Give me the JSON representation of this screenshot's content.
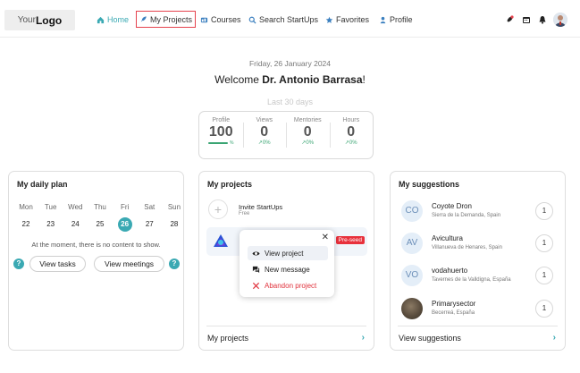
{
  "nav": {
    "logo_prefix": "Your",
    "logo_main": "Logo",
    "items": [
      {
        "label": "Home",
        "icon": "home-icon"
      },
      {
        "label": "My Projects",
        "icon": "rocket-icon"
      },
      {
        "label": "Courses",
        "icon": "courses-icon"
      },
      {
        "label": "Search StartUps",
        "icon": "search-icon"
      },
      {
        "label": "Favorites",
        "icon": "star-icon"
      },
      {
        "label": "Profile",
        "icon": "person-icon"
      }
    ],
    "active_item": "Home",
    "highlighted_item": "My Projects",
    "right_icons": [
      "rocket-icon",
      "calendar-icon",
      "bell-icon"
    ]
  },
  "header": {
    "date": "Friday, 26 January 2024",
    "welcome_prefix": "Welcome ",
    "user_name": "Dr. Antonio Barrasa",
    "welcome_suffix": "!",
    "period": "Last 30 days"
  },
  "stats": [
    {
      "label": "Profile",
      "value": "100",
      "extra": "%",
      "progress": 1.0
    },
    {
      "label": "Views",
      "value": "0",
      "extra": "0%"
    },
    {
      "label": "Mentories",
      "value": "0",
      "extra": "0%"
    },
    {
      "label": "Hours",
      "value": "0",
      "extra": "0%"
    }
  ],
  "daily_plan": {
    "title": "My daily plan",
    "days": [
      {
        "name": "Mon",
        "num": "22"
      },
      {
        "name": "Tue",
        "num": "23"
      },
      {
        "name": "Wed",
        "num": "24"
      },
      {
        "name": "Thu",
        "num": "25"
      },
      {
        "name": "Fri",
        "num": "26"
      },
      {
        "name": "Sat",
        "num": "27"
      },
      {
        "name": "Sun",
        "num": "28"
      }
    ],
    "today": "26",
    "empty_message": "At the moment, there is no content to show.",
    "view_tasks": "View tasks",
    "view_meetings": "View meetings",
    "help": "?"
  },
  "projects": {
    "title": "My projects",
    "invite_title": "Invite StartUps",
    "invite_subtitle": "Free",
    "badge": "Pre-seed",
    "menu": {
      "close": "✕",
      "view": "View project",
      "message": "New message",
      "abandon": "Abandon project"
    },
    "footer": "My projects"
  },
  "suggestions": {
    "title": "My suggestions",
    "items": [
      {
        "initials": "CO",
        "name": "Coyote Dron",
        "location": "Sierra de la Demanda, Spain",
        "count": "1"
      },
      {
        "initials": "AV",
        "name": "Avicultura",
        "location": "Villanueva de Henares, Spain",
        "count": "1"
      },
      {
        "initials": "VO",
        "name": "vodahuerto",
        "location": "Tavernes de la Valldigna, España",
        "count": "1"
      },
      {
        "initials": "",
        "name": "Primarysector",
        "location": "Becerreá, España",
        "count": "1"
      }
    ],
    "footer": "View suggestions"
  },
  "colors": {
    "accent": "#3aa9b3",
    "danger": "#e0323c",
    "highlight_border": "#e5424d",
    "positive": "#3aa573"
  }
}
